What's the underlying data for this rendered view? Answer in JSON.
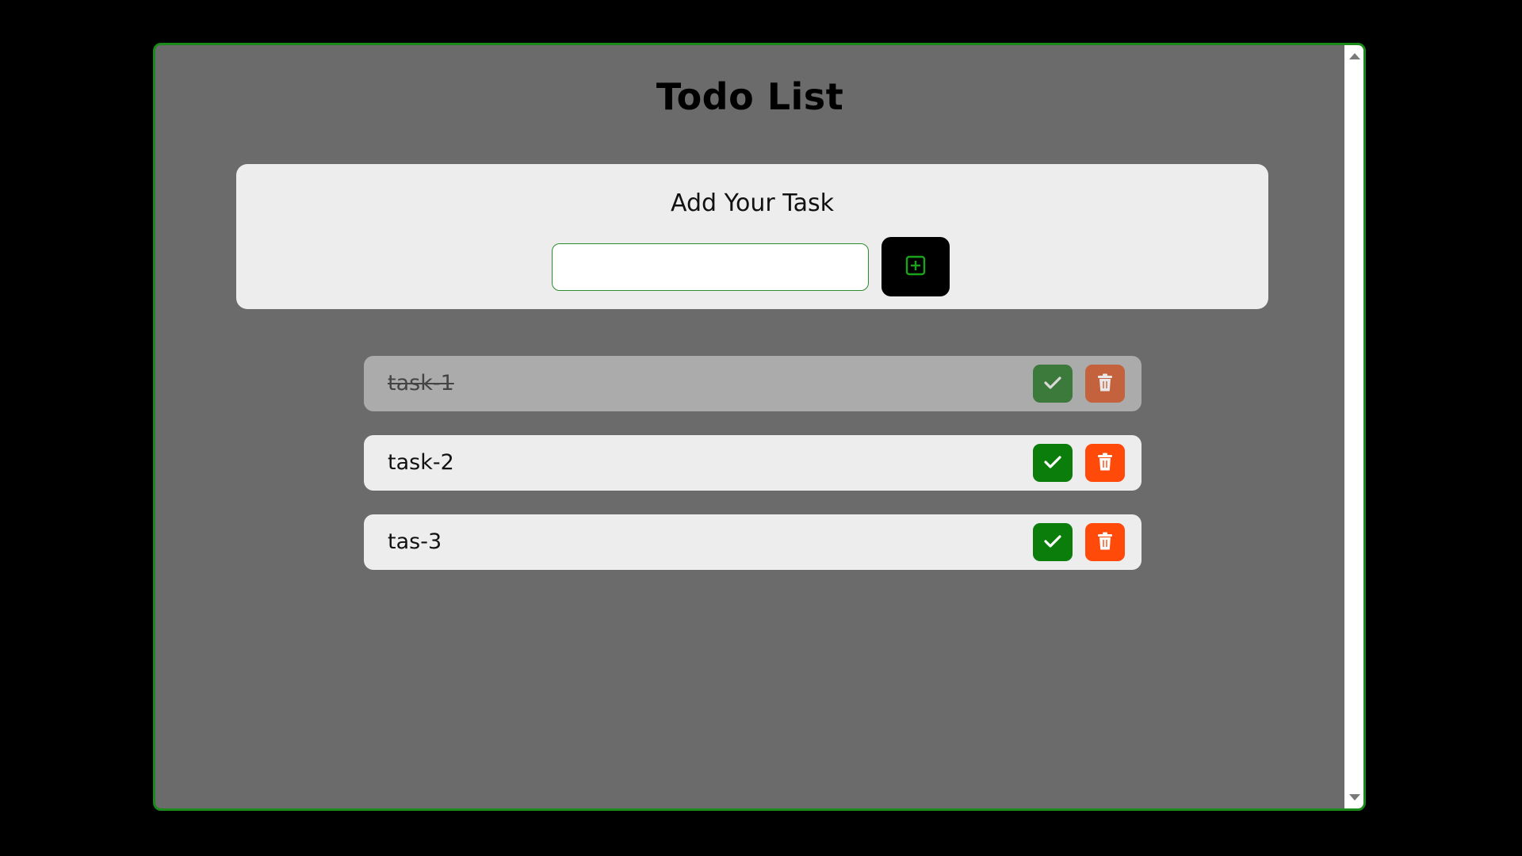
{
  "app": {
    "title": "Todo List"
  },
  "add_task": {
    "heading": "Add Your Task",
    "input_value": "",
    "input_placeholder": "",
    "add_button_icon": "plus-square-icon"
  },
  "tasks": [
    {
      "label": "task-1",
      "completed": true
    },
    {
      "label": "task-2",
      "completed": false
    },
    {
      "label": "tas-3",
      "completed": false
    }
  ],
  "task_actions": {
    "complete_icon": "check-icon",
    "delete_icon": "trash-icon"
  },
  "colors": {
    "frame_border": "#1a8a1a",
    "panel_background": "#6b6b6b",
    "card_background": "#ededed",
    "completed_background": "#ababab",
    "check_button": "#0a7d0a",
    "delete_button": "#ff4a0a",
    "add_button": "#000000",
    "add_icon": "#1aa31a"
  }
}
